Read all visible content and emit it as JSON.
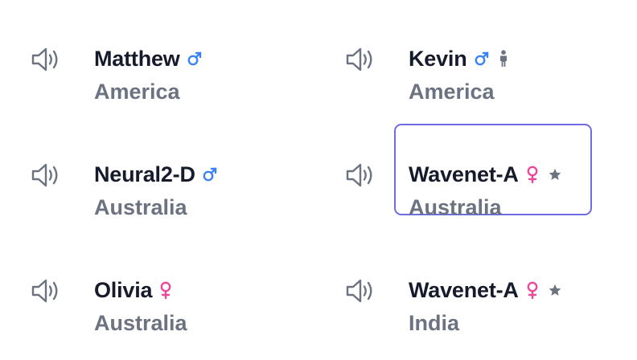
{
  "voices": [
    {
      "name": "Matthew",
      "region": "America",
      "gender": "male",
      "gender_icon": "male-symbol-icon",
      "extra_icon": null
    },
    {
      "name": "Kevin",
      "region": "America",
      "gender": "male",
      "gender_icon": "male-symbol-icon",
      "extra_icon": "child-figure-icon"
    },
    {
      "name": "Neural2-D",
      "region": "Australia",
      "gender": "male",
      "gender_icon": "male-symbol-icon",
      "extra_icon": null
    },
    {
      "name": "Wavenet-A",
      "region": "Australia",
      "gender": "female",
      "gender_icon": "female-symbol-icon",
      "extra_icon": "star-icon",
      "selected": true
    },
    {
      "name": "Olivia",
      "region": "Australia",
      "gender": "female",
      "gender_icon": "female-symbol-icon",
      "extra_icon": null
    },
    {
      "name": "Wavenet-A",
      "region": "India",
      "gender": "female",
      "gender_icon": "female-symbol-icon",
      "extra_icon": "star-icon"
    }
  ],
  "speaker_icon": "speaker-volume-icon",
  "colors": {
    "name_text": "#161b2c",
    "region_text": "#6b7280",
    "male": "#3b82f6",
    "female": "#ec4899",
    "icon_gray": "#6b7280",
    "selected_border": "#6e6ce0"
  }
}
